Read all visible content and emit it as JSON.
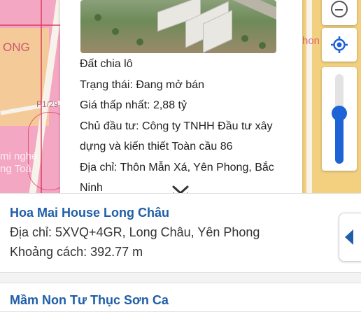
{
  "map": {
    "labels": [
      "ONG",
      "mi nghé",
      "ng Toà",
      "P1/29",
      "hon"
    ],
    "zoom_level_fraction": 0.56,
    "colors": {
      "zone_pink": "#f4a7c3",
      "zone_yellow": "#f2d07f",
      "accent_blue": "#1e63d6"
    },
    "icons": {
      "zoom_out": "minus-circle-icon",
      "locate": "locate-target-icon",
      "collapse": "double-chevron-down-icon"
    }
  },
  "popup": {
    "lines": [
      "Đất chia lô",
      "Trạng thái: Đang mở bán",
      "Giá thấp nhất: 2,88 tỷ",
      "Chủ đầu tư: Công ty TNHH Đầu tư xây",
      "dựng và kiến thiết Toàn cầu 86",
      "Địa chỉ: Thôn Mẫn Xá, Yên Phong, Bắc",
      "Ninh"
    ]
  },
  "list": {
    "items": [
      {
        "title": "Hoa Mai House Long Châu",
        "address": "Địa chỉ: 5XVQ+4GR, Long Châu, Yên Phong",
        "distance": "Khoảng cách: 392.77 m"
      },
      {
        "title": "Mầm Non Tư Thục Sơn Ca"
      }
    ],
    "side_tab_icon": "caret-left-icon"
  }
}
